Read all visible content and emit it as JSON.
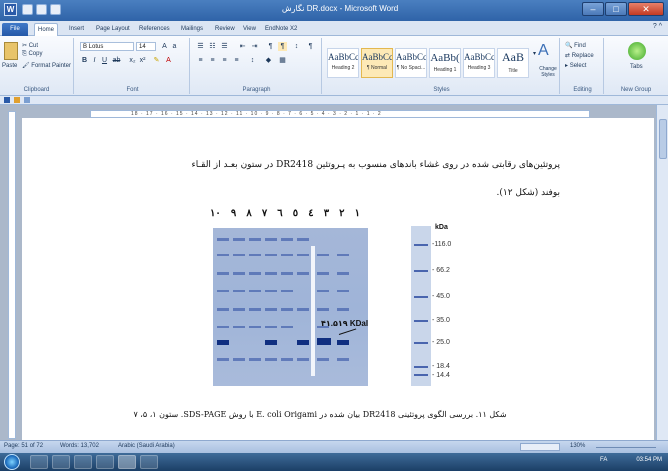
{
  "window": {
    "title": "نگارش DR.docx - Microsoft Word",
    "app_letter": "W"
  },
  "tabs": [
    "File",
    "Home",
    "Insert",
    "Page Layout",
    "References",
    "Mailings",
    "Review",
    "View",
    "EndNote X2"
  ],
  "help": "? ^",
  "clipboard": {
    "paste": "Paste",
    "cut": "Cut",
    "copy": "Copy",
    "format_painter": "Format Painter",
    "group": "Clipboard"
  },
  "font": {
    "name": "B Lotus",
    "size": "14",
    "group": "Font"
  },
  "paragraph": {
    "group": "Paragraph"
  },
  "styles": {
    "group": "Styles",
    "change": "Change Styles",
    "items": [
      {
        "sample": "AaBbCc",
        "name": "Heading 2"
      },
      {
        "sample": "AaBbCcI",
        "name": "¶ Normal"
      },
      {
        "sample": "AaBbCcI",
        "name": "¶ No Spaci..."
      },
      {
        "sample": "AaBb(",
        "name": "Heading 1"
      },
      {
        "sample": "AaBbCc",
        "name": "Heading 3"
      },
      {
        "sample": "AaB",
        "name": "Title"
      }
    ]
  },
  "editing": {
    "find": "Find",
    "replace": "Replace",
    "select": "Select",
    "group": "Editing"
  },
  "new_group": {
    "tabs": "Tabs",
    "group": "New Group"
  },
  "ruler": {
    "numbers": "18 · 17 · 16 · 15 · 14 · 13 · 12 · 11 · 10 · 9 · 8 · 7 · 6 · 5 · 4 · 3 · 2 · 1 · 1 · 2"
  },
  "document": {
    "line1": "پروتئین‌های رقابتی شده در روی غشاء باندهای منسوب به پـروتئین DR2418 در ستون بعـد از القـاء",
    "line2": "بوفند (شکل ١٢).",
    "lanes": [
      "١",
      "٢",
      "٣",
      "٤",
      "٥",
      "٦",
      "٧",
      "٨",
      "٩",
      "١٠"
    ],
    "kda": "kDa",
    "markers": [
      "-116.0",
      "- 66.2",
      "- 45.0",
      "- 35.0",
      "- 25.0",
      "- 18.4",
      "- 14.4"
    ],
    "annotation": "۴۱.۵۱۹ KDal",
    "caption": "شکل ۱۱. بررسی الگوی پروتئینی DR2418 بیان شده در E. coli Origami با روش SDS-PAGE. ستون ۱، ۵، ۷"
  },
  "status": {
    "page": "Page: 51 of 72",
    "words": "Words: 13,702",
    "lang": "Arabic (Saudi Arabia)",
    "zoom": "130%"
  },
  "taskbar": {
    "lang": "FA",
    "time": "03:54 PM"
  }
}
